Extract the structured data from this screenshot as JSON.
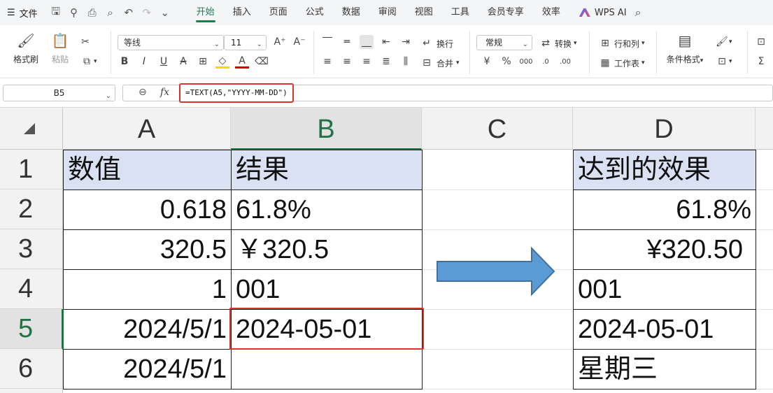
{
  "menubar": {
    "file_label": "文件",
    "tabs": [
      "开始",
      "插入",
      "页面",
      "公式",
      "数据",
      "审阅",
      "视图",
      "工具",
      "会员专享",
      "效率"
    ],
    "wps_ai_label": "WPS AI"
  },
  "ribbon": {
    "format_painter_label": "格式刷",
    "paste_label": "粘贴",
    "font_name": "等线",
    "font_size": "11",
    "wrap_text_label": "换行",
    "merge_label": "合并",
    "number_format": "常规",
    "convert_label": "转换",
    "rows_cols_label": "行和列",
    "worksheet_label": "工作表",
    "conditional_format_label": "条件格式"
  },
  "formula_bar": {
    "name_box": "B5",
    "fx_label": "fx",
    "formula": "=TEXT(A5,\"YYYY-MM-DD\")"
  },
  "sheet": {
    "columns": [
      "A",
      "B",
      "C",
      "D"
    ],
    "rows": [
      "1",
      "2",
      "3",
      "4",
      "5",
      "6"
    ],
    "colA": [
      "数值",
      "0.618",
      "320.5",
      "1",
      "2024/5/1",
      "2024/5/1"
    ],
    "colB": [
      "结果",
      "61.8%",
      "￥320.5",
      "001",
      "2024-05-01",
      ""
    ],
    "colD": [
      "达到的效果",
      "61.8%",
      "¥320.50",
      "001",
      "2024-05-01",
      "星期三"
    ]
  },
  "colors": {
    "accent": "#1a7f50",
    "highlight_red": "#d9352c",
    "header_fill": "#d9e1f2",
    "arrow_fill": "#5b9bd5"
  }
}
